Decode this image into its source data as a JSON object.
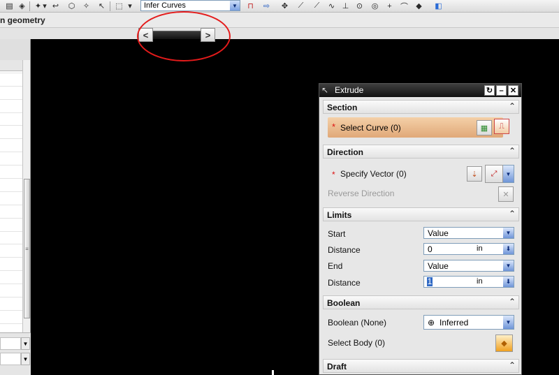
{
  "toolbar": {
    "icons": [
      "copy-icon",
      "paste-icon",
      "undo-icon",
      "sketch-icon",
      "select-icon",
      "dropdown-icon",
      "box-select-icon",
      "point-icon",
      "line-icon",
      "arc-icon",
      "circle-icon",
      "plus-icon",
      "move-icon",
      "cube-icon"
    ],
    "curve_rule": "Infer Curves",
    "glyphs": {
      "vector": "⇅",
      "arrow": "⇨"
    }
  },
  "bar2": {
    "label": "n geometry"
  },
  "scroll": {
    "left": "<",
    "right": ">"
  },
  "dialog": {
    "title": "Extrude",
    "section": {
      "header": "Section",
      "select_curve": "Select Curve (0)"
    },
    "direction": {
      "header": "Direction",
      "specify_vector": "Specify Vector (0)",
      "reverse": "Reverse Direction"
    },
    "limits": {
      "header": "Limits",
      "start_label": "Start",
      "start_value": "Value",
      "distance1_label": "Distance",
      "distance1_value": "0",
      "distance1_unit": "in",
      "end_label": "End",
      "end_value": "Value",
      "distance2_label": "Distance",
      "distance2_value": "1",
      "distance2_unit": "in"
    },
    "boolean": {
      "header": "Boolean",
      "boolean_label": "Boolean (None)",
      "boolean_value": "Inferred",
      "select_body": "Select Body (0)"
    },
    "draft": {
      "header": "Draft"
    },
    "required_mark": "*",
    "collapse_glyph": "⌃",
    "close_glyph": "✕",
    "minimize_glyph": "–",
    "reset_glyph": "↻"
  },
  "colors": {
    "ellipse": "#e41b1b",
    "select_row": "#f0c497",
    "canvas": "#000000"
  }
}
